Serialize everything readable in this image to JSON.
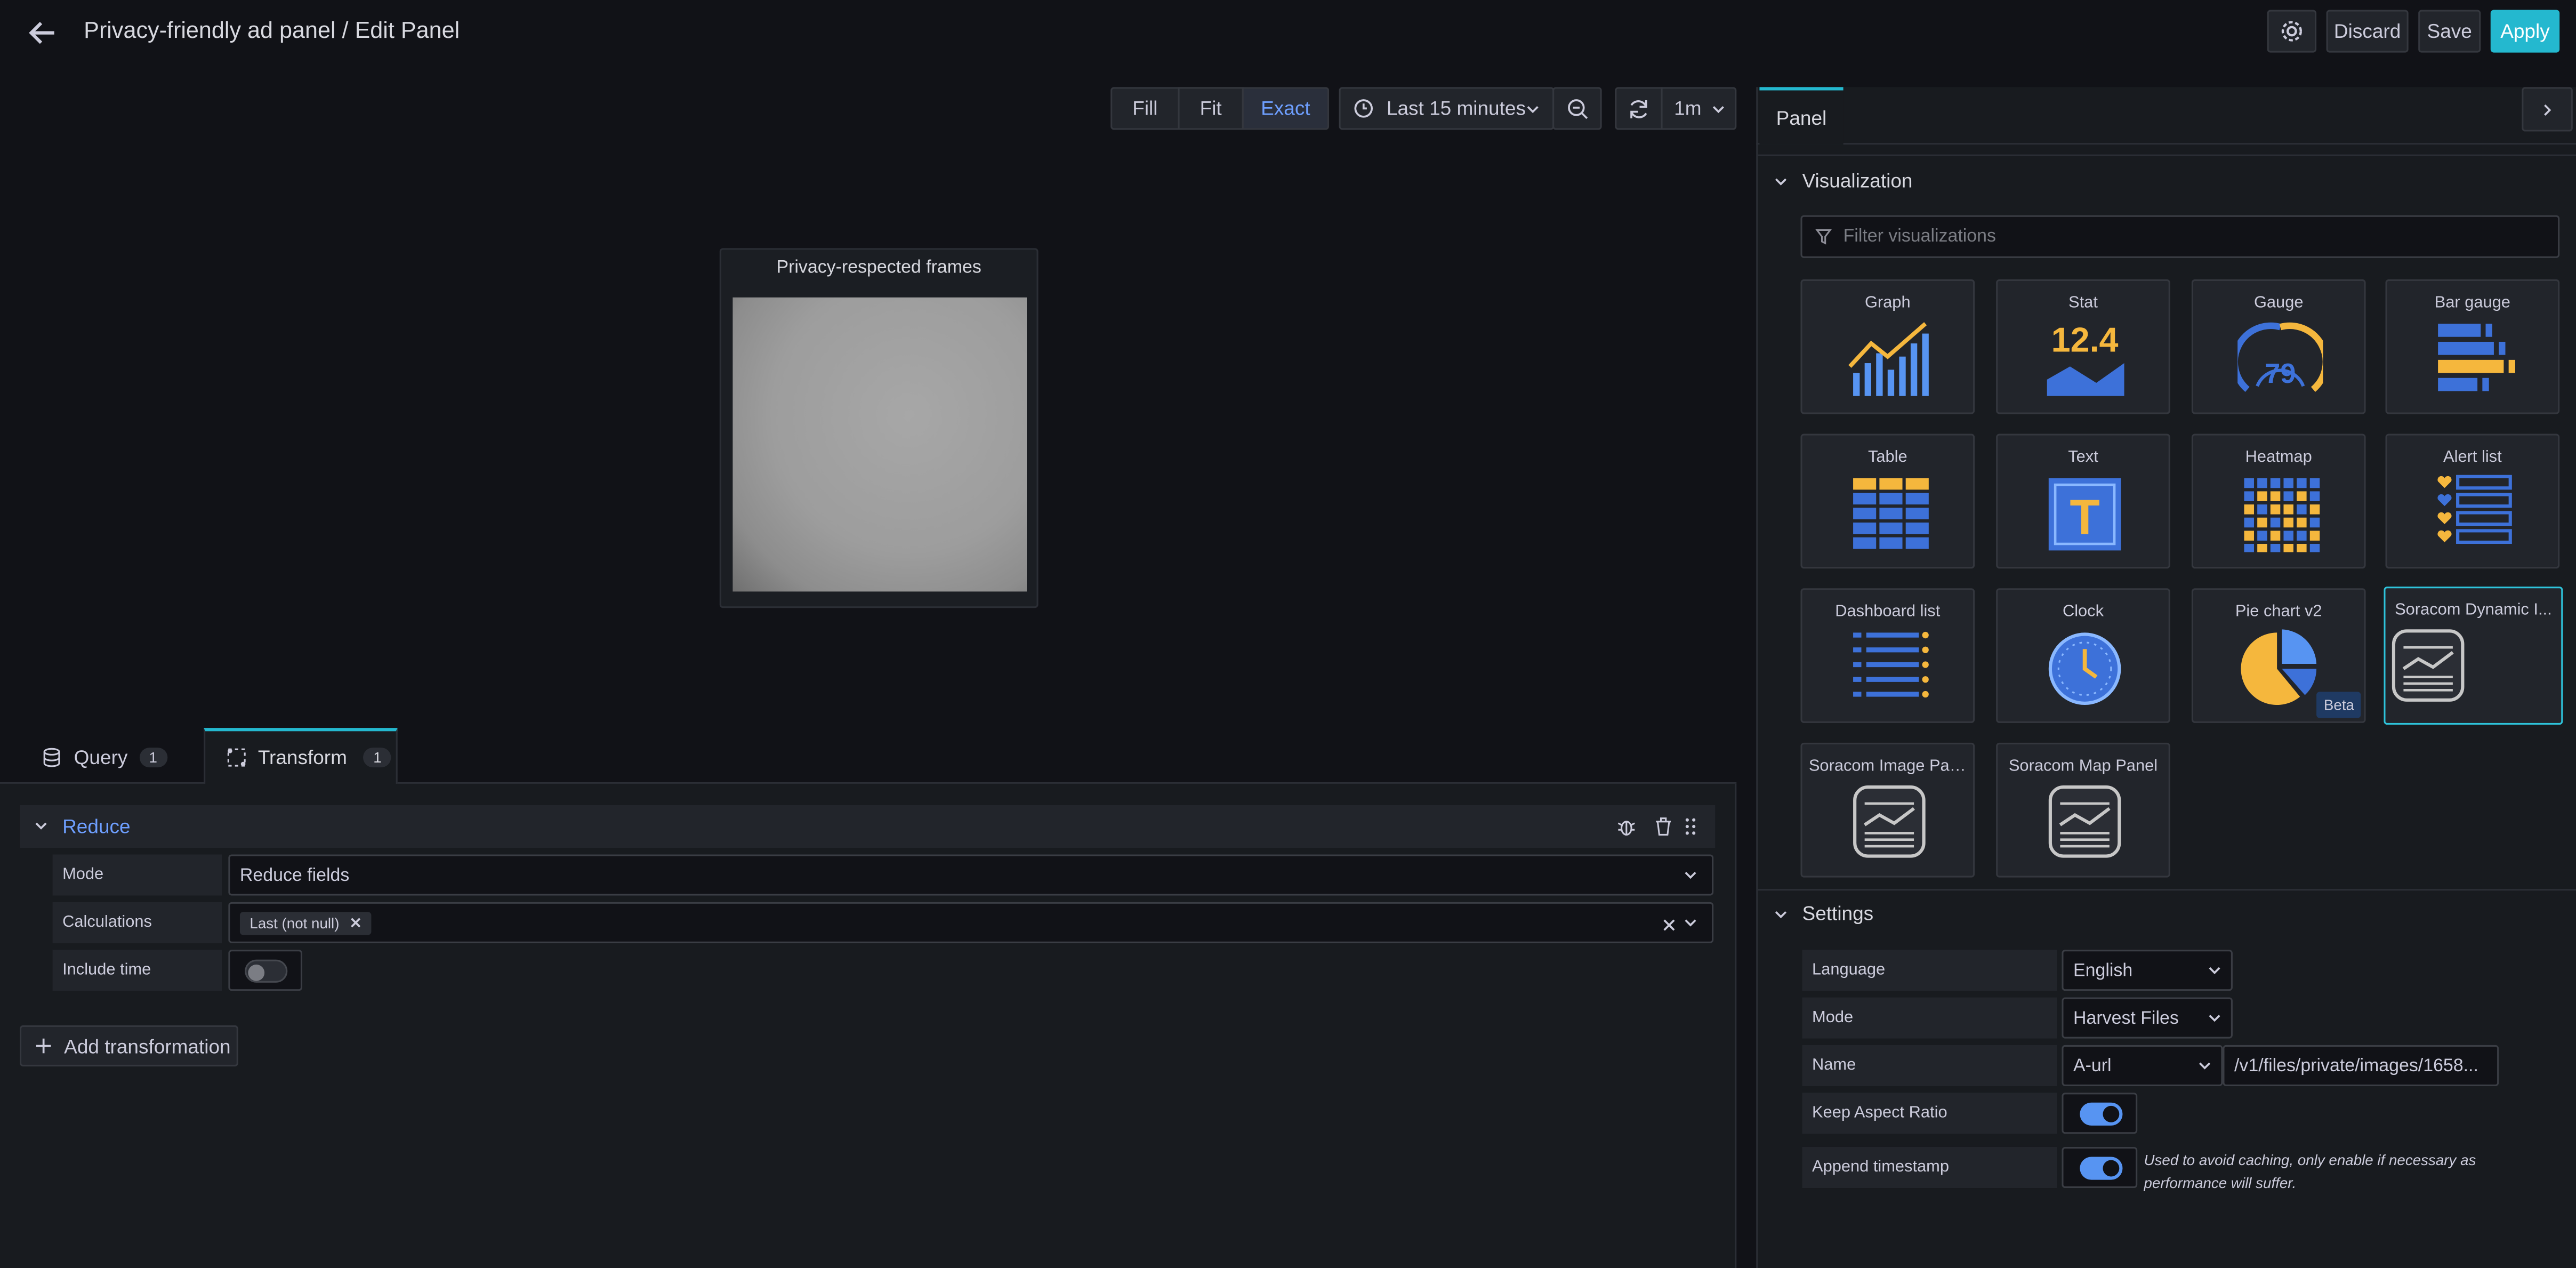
{
  "header": {
    "title": "Privacy-friendly ad panel / Edit Panel",
    "discard": "Discard",
    "save": "Save",
    "apply": "Apply"
  },
  "toolbar": {
    "fill": "Fill",
    "fit": "Fit",
    "exact": "Exact",
    "time_range": "Last 15 minutes",
    "refresh_interval": "1m"
  },
  "preview": {
    "panel_title": "Privacy-respected frames"
  },
  "editor_tabs": [
    {
      "label": "Query",
      "count": "1"
    },
    {
      "label": "Transform",
      "count": "1"
    }
  ],
  "transform": {
    "name": "Reduce",
    "mode_label": "Mode",
    "mode_value": "Reduce fields",
    "calc_label": "Calculations",
    "calc_tag": "Last (not null)",
    "include_time_label": "Include time",
    "add_button": "Add transformation"
  },
  "options": {
    "tab": "Panel",
    "visualization_section": "Visualization",
    "filter_placeholder": "Filter visualizations",
    "visualizations": [
      {
        "name": "Graph"
      },
      {
        "name": "Stat",
        "icon_text": "12.4"
      },
      {
        "name": "Gauge",
        "icon_text": "79"
      },
      {
        "name": "Bar gauge"
      },
      {
        "name": "Table"
      },
      {
        "name": "Text",
        "icon_text": "T"
      },
      {
        "name": "Heatmap"
      },
      {
        "name": "Alert list"
      },
      {
        "name": "Dashboard list"
      },
      {
        "name": "Clock"
      },
      {
        "name": "Pie chart v2",
        "badge": "Beta"
      },
      {
        "name": "Soracom Dynamic I..."
      },
      {
        "name": "Soracom Image Panel"
      },
      {
        "name": "Soracom Map Panel"
      }
    ],
    "settings_section": "Settings",
    "settings": {
      "language_label": "Language",
      "language_value": "English",
      "mode_label": "Mode",
      "mode_value": "Harvest Files",
      "name_label": "Name",
      "name_select": "A-url",
      "name_value": "/v1/files/private/images/1658...",
      "keep_aspect_label": "Keep Aspect Ratio",
      "append_ts_label": "Append timestamp",
      "append_ts_note": "Used to avoid caching, only enable if necessary as performance will suffer."
    }
  },
  "colors": {
    "background": "#111217",
    "panel": "#181b1f",
    "accent": "#3d71d9",
    "apply": "#24b8cf",
    "link": "#6e9fff",
    "selected_border": "#2ec4db",
    "yellow": "#f5b73d",
    "blue_icon": "#3d71d9"
  }
}
